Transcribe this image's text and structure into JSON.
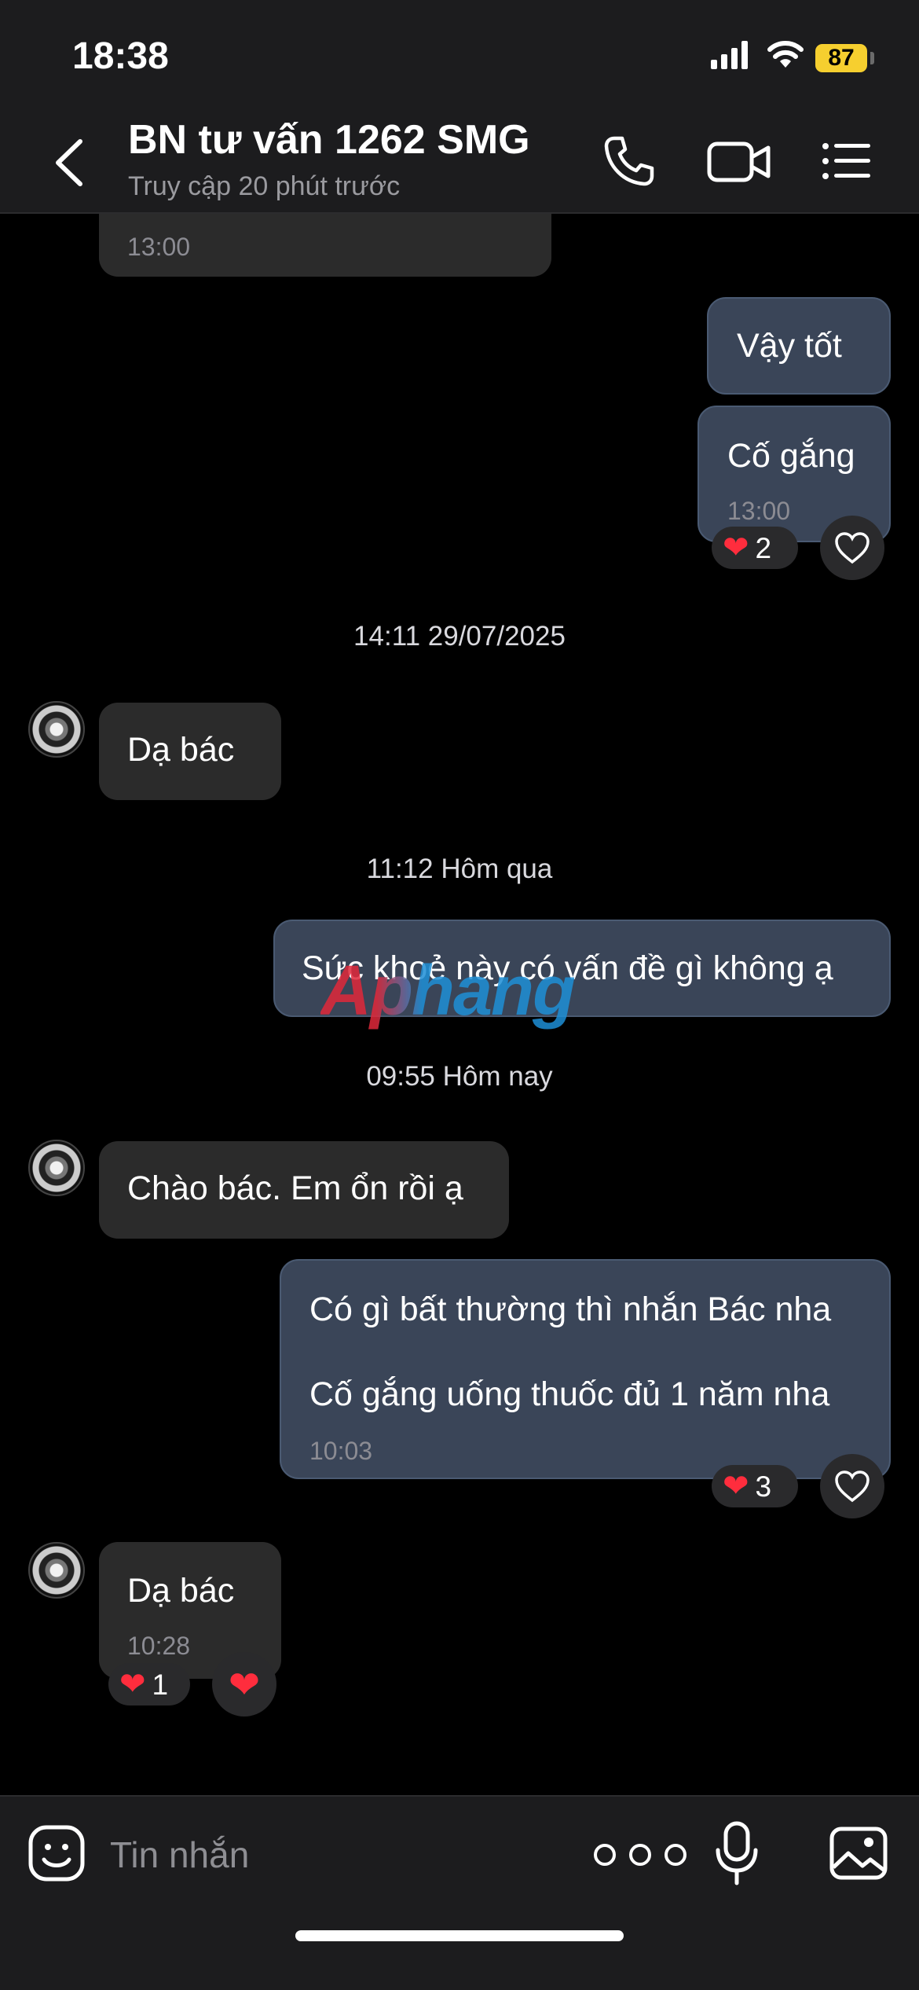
{
  "status_bar": {
    "time": "18:38",
    "battery": "87"
  },
  "header": {
    "title": "BN tư vấn 1262 SMG",
    "subtitle": "Truy cập 20 phút trước",
    "icons": [
      "back-icon",
      "phone-icon",
      "video-icon",
      "list-menu-icon"
    ]
  },
  "watermark": "Aphang",
  "messages": {
    "m0": {
      "time": "13:00"
    },
    "m1": {
      "text": "Vậy tốt"
    },
    "m2": {
      "text": "Cố gắng",
      "time": "13:00",
      "reaction_count": "2"
    },
    "sep1": "14:11 29/07/2025",
    "m3": {
      "text": "Dạ bác"
    },
    "sep2": "11:12 Hôm qua",
    "m4": {
      "text": "Sức khoẻ này có vấn đề gì không ạ"
    },
    "sep3": "09:55 Hôm nay",
    "m5": {
      "text": "Chào bác. Em ổn rồi ạ"
    },
    "m6": {
      "line1": "Có gì bất thường thì nhắn Bác nha",
      "line2": "Cố gắng uống thuốc đủ 1 năm nha",
      "time": "10:03",
      "reaction_count": "3"
    },
    "m7": {
      "text": "Dạ bác",
      "time": "10:28",
      "reaction_count": "1"
    }
  },
  "input_bar": {
    "placeholder": "Tin nhắn",
    "icons": [
      "emoji-icon",
      "more-icon",
      "microphone-icon",
      "image-icon"
    ]
  },
  "colors": {
    "background": "#000000",
    "incoming_bubble": "#2b2b2b",
    "outgoing_bubble": "#3a4558",
    "heart": "#ff2d3d",
    "battery": "#f6cf2f"
  }
}
